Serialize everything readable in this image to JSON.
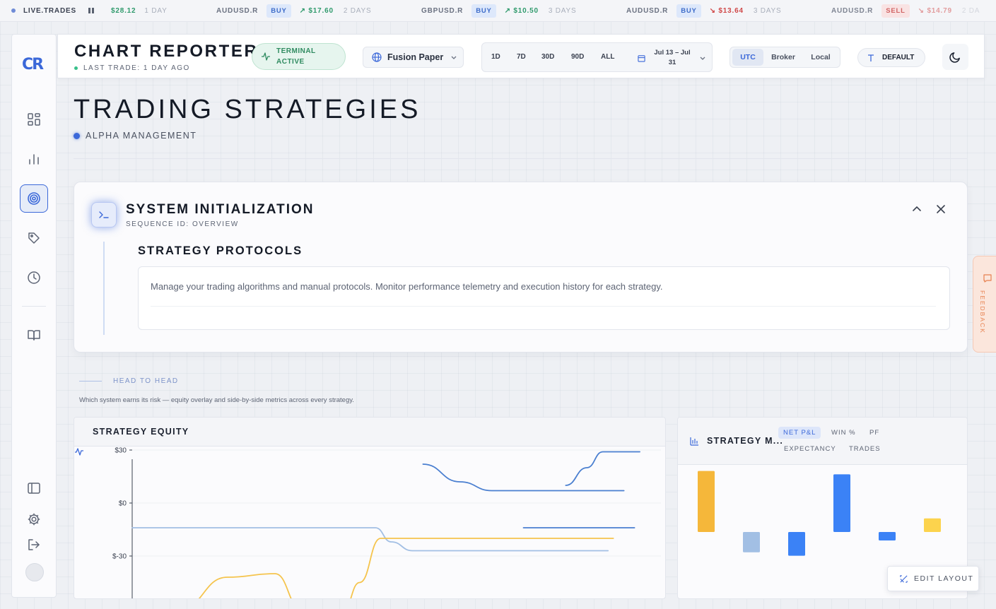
{
  "ticker": {
    "live_label": "LIVE.TRADES",
    "first": {
      "amount": "$28.12",
      "age": "1 DAY"
    },
    "items": [
      {
        "symbol": "AUDUSD.R",
        "side": "BUY",
        "amount": "$17.60",
        "age": "2 DAYS",
        "dir": "up"
      },
      {
        "symbol": "GBPUSD.R",
        "side": "BUY",
        "amount": "$10.50",
        "age": "3 DAYS",
        "dir": "up"
      },
      {
        "symbol": "AUDUSD.R",
        "side": "BUY",
        "amount": "$13.64",
        "age": "3 DAYS",
        "dir": "down"
      },
      {
        "symbol": "AUDUSD.R",
        "side": "SELL",
        "amount": "$14.79",
        "age": "2 DA",
        "dir": "down"
      }
    ]
  },
  "sidebar": {
    "logo": "CR",
    "icons": [
      "dashboard-icon",
      "chart-bars-icon",
      "target-icon",
      "tag-icon",
      "clock-icon",
      "book-icon",
      "panel-icon",
      "gear-icon",
      "logout-icon"
    ]
  },
  "header": {
    "title": "CHART REPORTER",
    "last_trade": "LAST TRADE: 1 DAY AGO",
    "status": "TERMINAL ACTIVE",
    "account": "Fusion Paper",
    "ranges": [
      "1D",
      "7D",
      "30D",
      "90D",
      "ALL"
    ],
    "date_range": "Jul 13 – Jul 31",
    "timezones": [
      "UTC",
      "Broker",
      "Local"
    ],
    "active_timezone": "UTC",
    "template": "DEFAULT"
  },
  "page": {
    "title": "TRADING STRATEGIES",
    "subtitle": "ALPHA MANAGEMENT"
  },
  "init_card": {
    "title": "SYSTEM INITIALIZATION",
    "sequence": "SEQUENCE ID: OVERVIEW",
    "section_title": "STRATEGY PROTOCOLS",
    "description": "Manage your trading algorithms and manual protocols. Monitor performance telemetry and execution history for each strategy."
  },
  "feedback": "FEEDBACK",
  "head_to_head": {
    "label": "HEAD TO HEAD",
    "description": "Which system earns its risk — equity overlay and side-by-side metrics across every strategy."
  },
  "equity_panel": {
    "title": "STRATEGY EQUITY",
    "y_ticks": [
      "$30",
      "$0",
      "$-30"
    ]
  },
  "metrics_panel": {
    "title": "STRATEGY M...",
    "tabs": [
      "NET P&L",
      "WIN %",
      "PF",
      "EXPECTANCY",
      "TRADES"
    ],
    "active_tab": "NET P&L"
  },
  "edit_layout": "EDIT LAYOUT",
  "colors": {
    "accent": "#3b68d9",
    "positive": "#2f9a6c",
    "negative": "#d04747",
    "series_blue": "#4a7fd0",
    "series_lightblue": "#a2bfe4",
    "series_yellow": "#f5c44d"
  },
  "chart_data": [
    {
      "type": "line",
      "title": "STRATEGY EQUITY",
      "ylim": [
        -60,
        40
      ],
      "yticks": [
        30,
        0,
        -30
      ],
      "grid": true,
      "series": [
        {
          "color": "#4a7fd0",
          "x": [
            0.55,
            0.62,
            0.68,
            0.75,
            0.8,
            0.86,
            0.93
          ],
          "values": [
            22,
            12,
            7,
            7,
            7,
            7,
            7
          ]
        },
        {
          "color": "#4a7fd0",
          "x": [
            0.82,
            0.86,
            0.89,
            0.93,
            0.96
          ],
          "values": [
            10,
            20,
            29,
            29,
            29
          ]
        },
        {
          "color": "#4a7fd0",
          "x": [
            0.74,
            0.84,
            0.95
          ],
          "values": [
            -14,
            -14,
            -14
          ]
        },
        {
          "color": "#a2bfe4",
          "x": [
            0.0,
            0.25,
            0.46,
            0.49,
            0.53,
            0.64,
            0.9
          ],
          "values": [
            -14,
            -14,
            -14,
            -22,
            -27,
            -27,
            -27
          ]
        },
        {
          "color": "#f5c44d",
          "x": [
            0.09,
            0.18,
            0.27,
            0.32,
            0.4,
            0.43,
            0.47,
            0.65,
            0.91
          ],
          "values": [
            -60,
            -42,
            -40,
            -60,
            -60,
            -45,
            -20,
            -20,
            -20
          ]
        }
      ]
    },
    {
      "type": "bar",
      "title": "STRATEGY M...",
      "ylim": [
        -40,
        40
      ],
      "values": [
        36,
        -12,
        -14,
        34,
        -5,
        8
      ],
      "colors": [
        "#f5b73a",
        "#a2bfe4",
        "#3b82f6",
        "#3b82f6",
        "#3b82f6",
        "#fcd34d"
      ]
    }
  ]
}
